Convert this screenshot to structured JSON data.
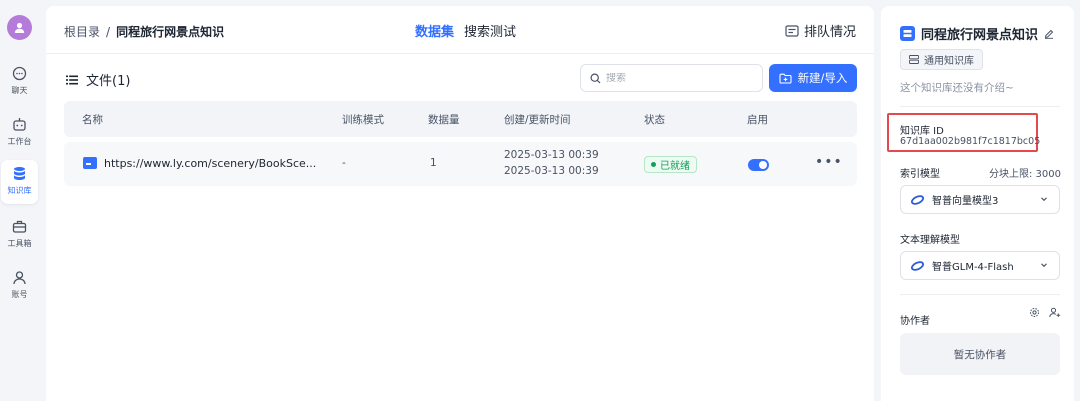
{
  "nav": {
    "items": [
      {
        "icon": "chat-icon",
        "label": "聊天"
      },
      {
        "icon": "robot-icon",
        "label": "工作台"
      },
      {
        "icon": "database-icon",
        "label": "知识库"
      },
      {
        "icon": "toolbox-icon",
        "label": "工具箱"
      },
      {
        "icon": "user-icon",
        "label": "账号"
      }
    ],
    "active": "知识库"
  },
  "header": {
    "breadcrumb_root": "根目录",
    "breadcrumb_sep": "/",
    "breadcrumb_current": "同程旅行网景点知识",
    "tabs": [
      "数据集",
      "搜索测试"
    ],
    "active_tab": "数据集",
    "queue_label": "排队情况"
  },
  "files": {
    "title": "文件(1)",
    "search_placeholder": "搜索",
    "new_button": "新建/导入"
  },
  "table": {
    "columns": [
      "名称",
      "训练模式",
      "数据量",
      "创建/更新时间",
      "状态",
      "启用"
    ],
    "rows": [
      {
        "name": "https://www.ly.com/scenery/BookSce...",
        "mode": "-",
        "count": "1",
        "created": "2025-03-13 00:39",
        "updated": "2025-03-13 00:39",
        "status": "已就绪",
        "enabled": true
      }
    ]
  },
  "side": {
    "kb_name": "同程旅行网景点知识",
    "tag": "通用知识库",
    "intro": "这个知识库还没有介绍~",
    "id_label": "知识库 ID",
    "id_value": "67d1aa002b981f7c1817bc05",
    "index_model_label": "索引模型",
    "chunk_limit": "分块上限: 3000",
    "index_model": "智普向量模型3",
    "text_model_label": "文本理解模型",
    "text_model": "智普GLM-4-Flash",
    "collab_label": "协作者",
    "no_collab": "暂无协作者"
  },
  "colors": {
    "accent": "#3370ff",
    "success": "#13a05a",
    "highlight": "#e5484d"
  }
}
